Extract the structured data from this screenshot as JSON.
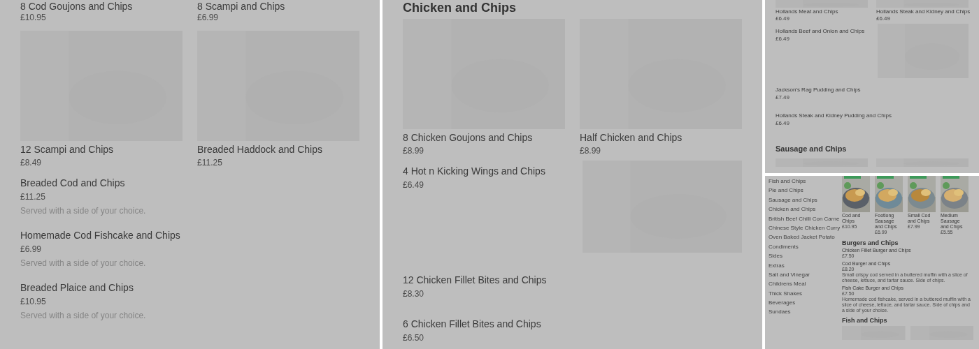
{
  "left_panel": {
    "top_cards": [
      {
        "name": "8 Cod Goujons and Chips",
        "price": "£10.95"
      },
      {
        "name": "8 Scampi and Chips",
        "price": "£6.99"
      }
    ],
    "image_cards": [
      {
        "name": "12 Scampi and Chips",
        "price": "£8.49"
      },
      {
        "name": "Breaded Haddock and Chips",
        "price": "£11.25"
      }
    ],
    "items": [
      {
        "name": "Breaded Cod and Chips",
        "price": "£11.25",
        "description": "Served with a side of your choice."
      },
      {
        "name": "Homemade Cod Fishcake and Chips",
        "price": "£6.99",
        "description": "Served with a side of your choice."
      },
      {
        "name": "Breaded Plaice and Chips",
        "price": "£10.95",
        "description": "Served with a side of your choice."
      }
    ]
  },
  "middle_panel": {
    "heading": "Chicken and Chips",
    "image_cards": [
      {
        "name": "8 Chicken Goujons and Chips",
        "price": "£8.99"
      },
      {
        "name": "Half Chicken and Chips",
        "price": "£8.99"
      }
    ],
    "items": [
      {
        "kind": "with_picture",
        "name": "4 Hot n Kicking Wings and Chips",
        "price": "£6.49"
      },
      {
        "kind": "plain",
        "name": "12 Chicken Fillet Bites and Chips",
        "price": "£8.30"
      },
      {
        "kind": "plain",
        "name": "6 Chicken Fillet Bites and Chips",
        "price": "£6.50"
      }
    ]
  },
  "right_top_panel": {
    "top_cards": [
      {
        "name": "Hollands Meat and Chips",
        "price": "£6.49"
      },
      {
        "name": "Hollands Steak and Kidney and Chips",
        "price": "£6.49"
      }
    ],
    "items": [
      {
        "kind": "with_picture",
        "name": "Hollands Beef and Onion and Chips",
        "price": "£6.49"
      },
      {
        "kind": "plain",
        "name": "Jackson's Rag Pudding and Chips",
        "price": "£7.49"
      },
      {
        "kind": "plain",
        "name": "Hollands Steak and Kidney Pudding and Chips",
        "price": "£6.49"
      }
    ],
    "heading": "Sausage and Chips"
  },
  "right_bottom_panel": {
    "sidebar": [
      "Fish and Chips",
      "Pie and Chips",
      "Sausage and Chips",
      "Chicken and Chips",
      "British Beef Chilli Con Carne",
      "Chinese Style Chicken Curry",
      "Oven Baked Jacket Potato",
      "Condiments",
      "Sides",
      "Extras",
      "Salt and Vinegar",
      "Childrens Meal",
      "Thick Shakes",
      "Beverages",
      "Sundaes"
    ],
    "featured": [
      {
        "name": "Cod and Chips",
        "price": "£10.95"
      },
      {
        "name": "Footlong Sausage and Chips",
        "price": "£6.99"
      },
      {
        "name": "Small Cod and Chips",
        "price": "£7.99"
      },
      {
        "name": "Medium Sausage and Chips",
        "price": "£5.55"
      }
    ],
    "section": {
      "heading": "Burgers and Chips",
      "items": [
        {
          "name": "Chicken Fillet Burger and Chips",
          "price": "£7.50"
        },
        {
          "name": "Cod Burger and Chips",
          "price": "£8.20",
          "description": "Small crispy cod served in a buttered muffin with a slice of cheese, lettuce, and tartar sauce. Side of chips."
        },
        {
          "name": "Fish Cake Burger and Chips",
          "price": "£7.50",
          "description": "Homemade cod fishcake, served in a buttered muffin with a slice of cheese, lettuce, and tartar sauce. Side of chips and a side of your choice."
        }
      ]
    },
    "next_heading": "Fish and Chips"
  }
}
